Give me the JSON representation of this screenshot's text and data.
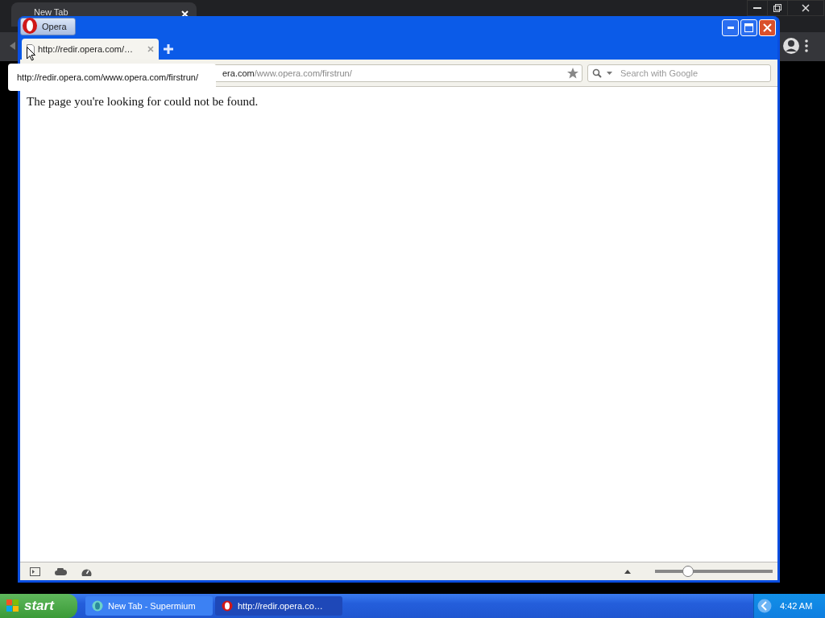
{
  "background_window": {
    "tab": {
      "title": "New Tab"
    }
  },
  "opera_window": {
    "menu_button": "Opera",
    "tabs": [
      {
        "title": "http://redir.opera.com/…",
        "selected": true
      }
    ],
    "address": {
      "host_tail": "era.com",
      "path": "/www.opera.com/firstrun/"
    },
    "search": {
      "placeholder": "Search with Google"
    },
    "tooltip": "http://redir.opera.com/www.opera.com/firstrun/",
    "page": {
      "message": "The page you're looking for could not be found."
    },
    "status_bar": {
      "zoom": {
        "level": 0.28
      }
    }
  },
  "taskbar": {
    "start": "start",
    "tasks": [
      {
        "label": "New Tab - Supermium",
        "selected": false
      },
      {
        "label": "http://redir.opera.co…",
        "selected": true
      }
    ],
    "clock": "4:42 AM"
  }
}
